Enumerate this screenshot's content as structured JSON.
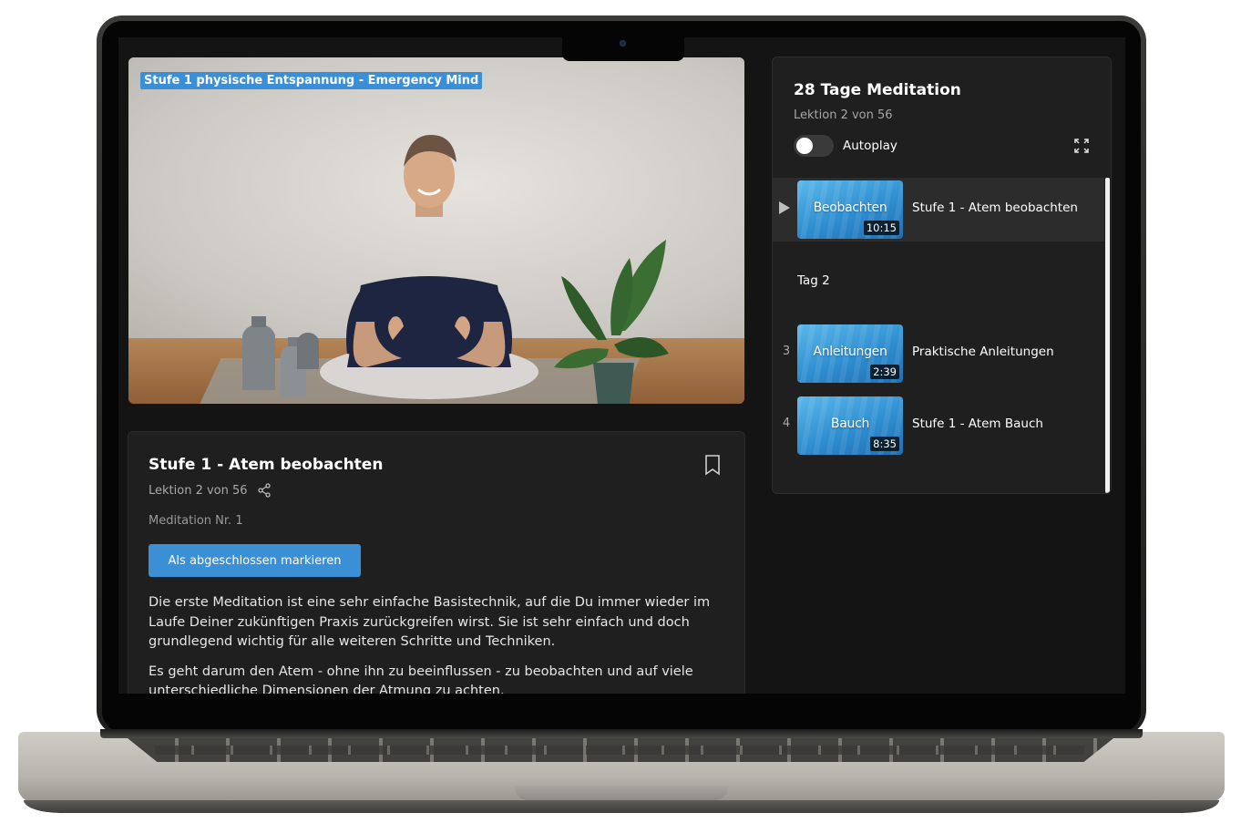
{
  "video": {
    "overlay_title": "Stufe 1 physische Entspannung - Emergency Mind"
  },
  "lesson": {
    "title": "Stufe 1 - Atem beobachten",
    "position": "Lektion 2 von 56",
    "meta": "Meditation Nr. 1",
    "complete_label": "Als abgeschlossen markieren",
    "description": [
      "Die erste Meditation ist eine sehr einfache Basistechnik, auf die Du immer wieder im Laufe Deiner zukünftigen Praxis zurückgreifen wirst. Sie ist sehr einfach und doch grundlegend wichtig für alle weiteren Schritte und Techniken.",
      "Es geht darum den Atem - ohne ihn zu beeinflussen - zu beobachten und auf viele unterschiedliche Dimensionen der Atmung zu achten."
    ]
  },
  "sidebar": {
    "course_title": "28 Tage Meditation",
    "position": "Lektion 2 von 56",
    "autoplay_label": "Autoplay",
    "autoplay_on": false,
    "items": [
      {
        "number": "",
        "thumb_word": "Beobachten",
        "duration": "10:15",
        "title": "Stufe 1 - Atem beobachten",
        "active": true
      },
      {
        "number": "3",
        "thumb_word": "Anleitungen",
        "duration": "2:39",
        "title": "Praktische Anleitungen",
        "active": false
      },
      {
        "number": "4",
        "thumb_word": "Bauch",
        "duration": "8:35",
        "title": "Stufe 1 - Atem Bauch",
        "active": false
      }
    ],
    "day_label": "Tag 2"
  },
  "colors": {
    "accent": "#3b8fd4",
    "background": "#141414",
    "panel": "#1f1f1f",
    "active_row": "#2c2c2c"
  }
}
